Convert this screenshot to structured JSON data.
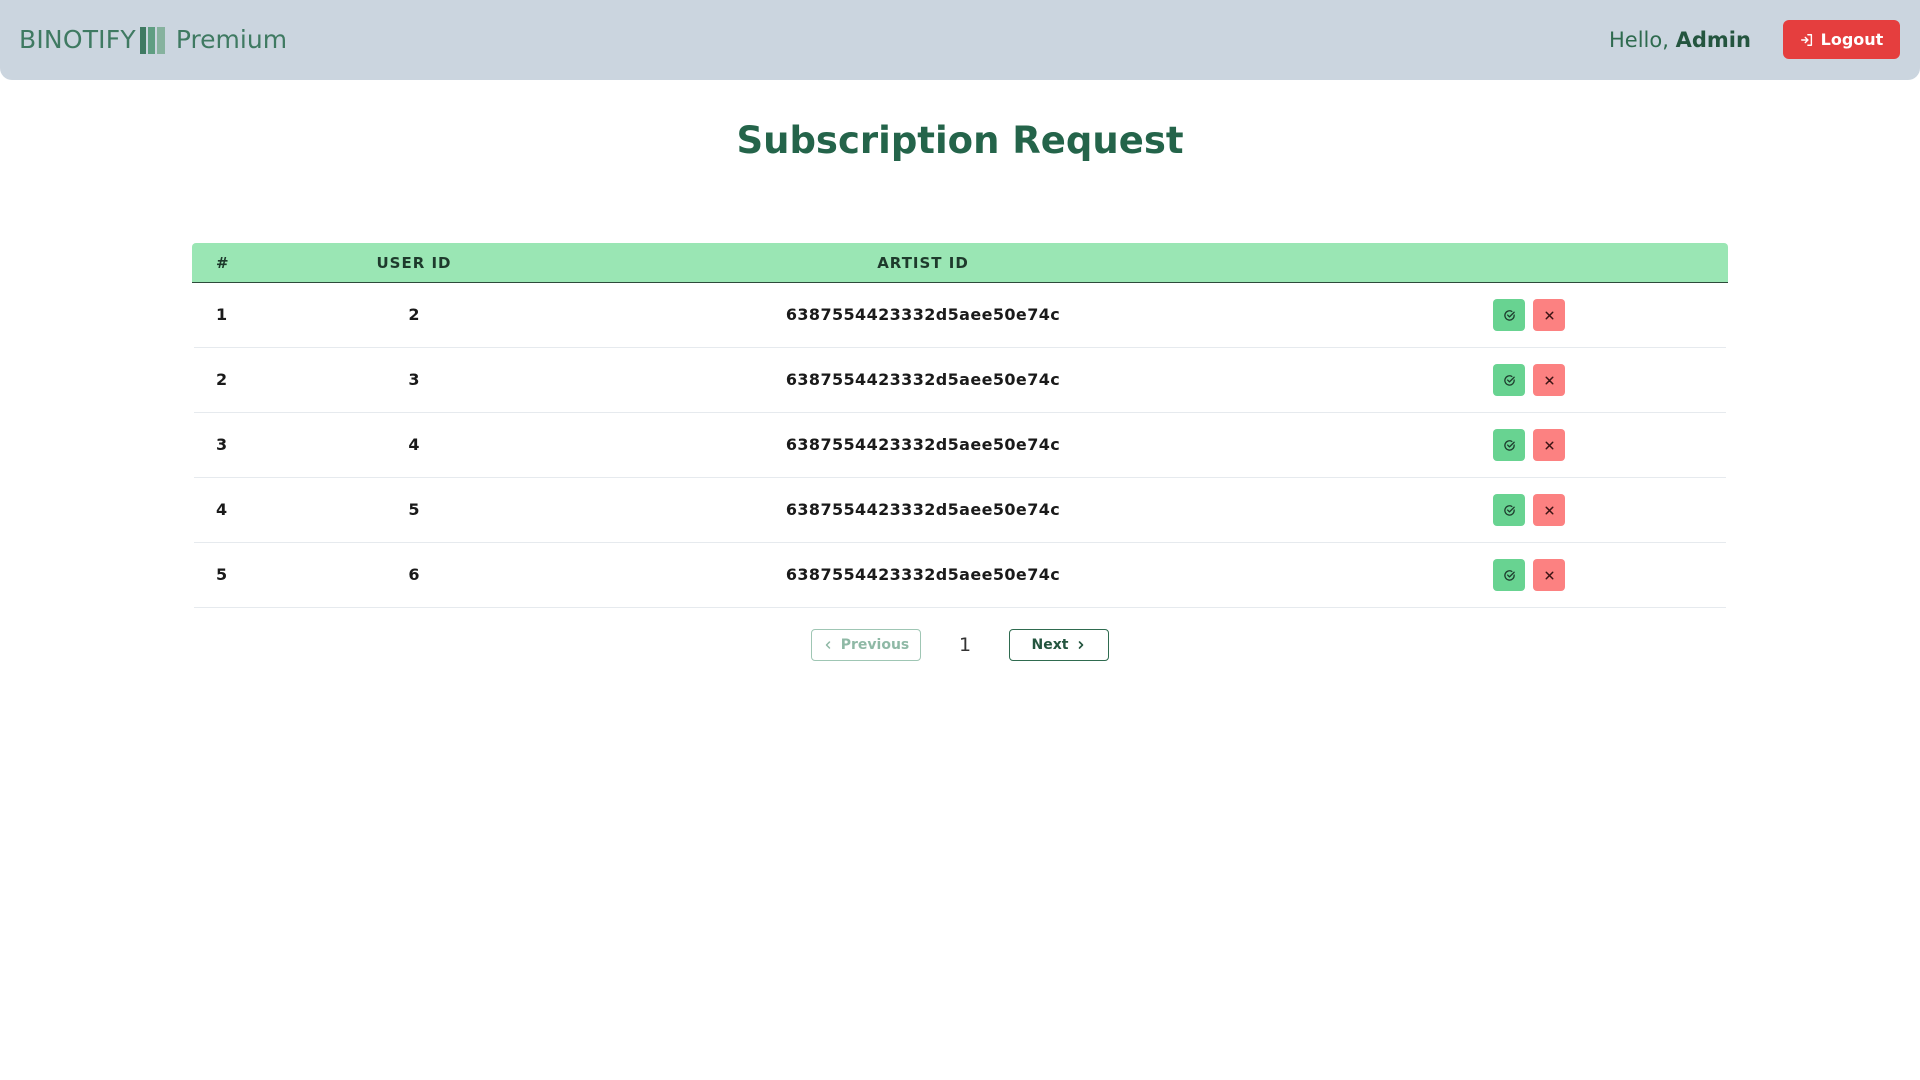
{
  "navbar": {
    "brand_name": "BINOTIFY",
    "brand_tier": "Premium",
    "greeting_prefix": "Hello, ",
    "username": "Admin",
    "logout_label": "Logout"
  },
  "page": {
    "title": "Subscription Request"
  },
  "table": {
    "headers": [
      "#",
      "USER ID",
      "ARTIST ID",
      ""
    ],
    "rows": [
      {
        "num": "1",
        "user_id": "2",
        "artist_id": "6387554423332d5aee50e74c"
      },
      {
        "num": "2",
        "user_id": "3",
        "artist_id": "6387554423332d5aee50e74c"
      },
      {
        "num": "3",
        "user_id": "4",
        "artist_id": "6387554423332d5aee50e74c"
      },
      {
        "num": "4",
        "user_id": "5",
        "artist_id": "6387554423332d5aee50e74c"
      },
      {
        "num": "5",
        "user_id": "6",
        "artist_id": "6387554423332d5aee50e74c"
      }
    ],
    "accept_icon": "check-circle-icon",
    "reject_icon": "close-icon"
  },
  "pagination": {
    "previous_label": "Previous",
    "next_label": "Next",
    "current_page": "1",
    "previous_enabled": false
  },
  "colors": {
    "navbar_bg": "#cbd5df",
    "brand": "#3f7a62",
    "title": "#24644a",
    "table_header_bg": "#9ae6b4",
    "accept": "#68d391",
    "reject": "#fc8181",
    "logout": "#e53e3e"
  }
}
